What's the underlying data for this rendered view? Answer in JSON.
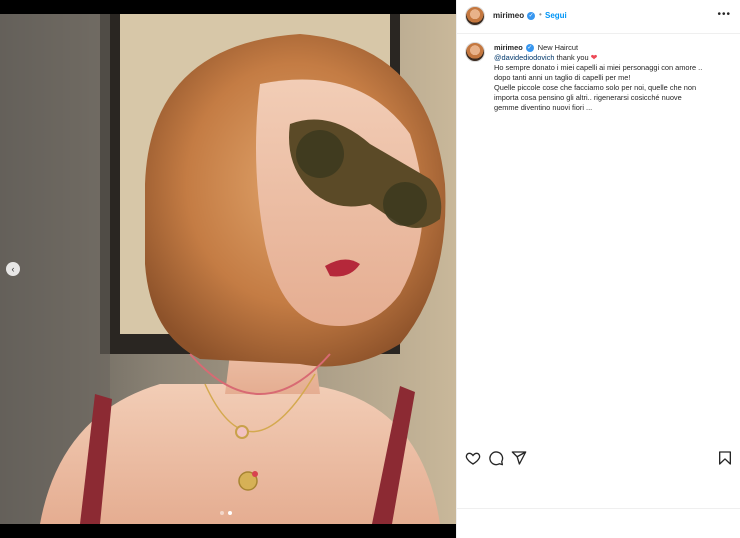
{
  "post": {
    "username": "mirimeo",
    "follow_label": "Segui",
    "separator": "•",
    "more_label": "•••",
    "caption": {
      "username": "mirimeo",
      "title": "New Haircut",
      "mention": "@davidediodovich",
      "thanks": " thank you ",
      "heart": "❤",
      "lines": [
        "Ho sempre donato i miei capelli ai miei personaggi con amore ..",
        "dopo tanti anni un taglio di capelli per me!",
        "Quelle piccole cose che facciamo solo per noi, quelle che non",
        "importa cosa pensino gli altri.. rigenerarsi cosicché nuove",
        "gemme diventino nuovi fiori ..."
      ]
    },
    "carousel": {
      "prev_label": "‹",
      "total": 2,
      "active_index": 1
    },
    "icons": {
      "avatar": "profile-photo",
      "verified": "verified-badge-icon",
      "like": "heart-icon",
      "comment": "comment-bubble-icon",
      "share": "paper-plane-icon",
      "save": "bookmark-icon"
    },
    "colors": {
      "link": "#0095f6",
      "verified": "#3897f0",
      "mention": "#00376b",
      "heart": "#ed4956"
    }
  }
}
